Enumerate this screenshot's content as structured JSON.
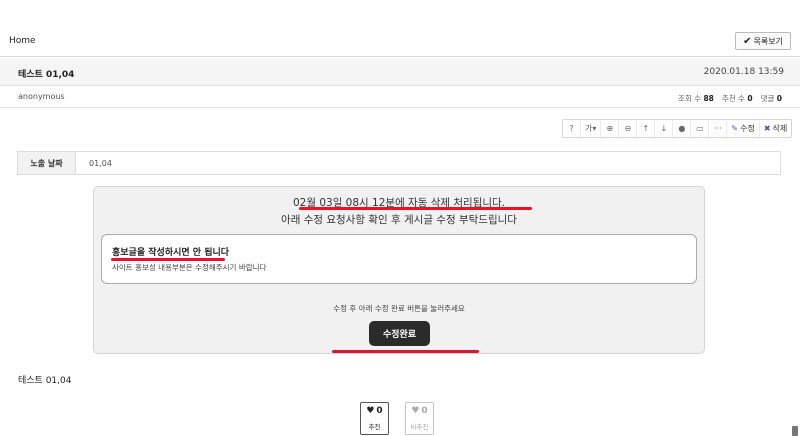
{
  "header": {
    "breadcrumb": "Home",
    "list_button": "목록보기",
    "list_button_icon": "checkmark-icon"
  },
  "post": {
    "title": "테스트 01,04",
    "date": "2020.01.18 13:59",
    "author": "anonymous",
    "views_label": "조회 수",
    "views": "88",
    "likes_label": "추천 수",
    "likes": "0",
    "comments_label": "댓글",
    "comments": "0",
    "body": "테스트 01,04"
  },
  "toolbar": {
    "help": "?",
    "font": "가",
    "font_caret": "▾",
    "zoom_in": "⊕",
    "zoom_out": "⊖",
    "up": "↑",
    "down": "↓",
    "comment": "●",
    "print": "▭",
    "more": "···",
    "edit_label": "수정",
    "delete_label": "삭제"
  },
  "exposure": {
    "label": "노출 날짜",
    "value": "01,04"
  },
  "notice": {
    "line1": "02월 03일 08시 12분에 자동 삭제 처리됩니다.",
    "line2": "아래 수정 요청사항 확인 후 게시글 수정 부탁드립니다",
    "request_title": "홍보글을 작성하시면 안 됩니다",
    "request_desc": "사이트 홍보성 내용부분은 수정해주시기 바랍니다",
    "done_hint": "수정 후 아래 수정 완료 버튼을 눌러주세요",
    "done_button": "수정완료"
  },
  "vote": {
    "up_count": "0",
    "up_label": "추천",
    "down_count": "0",
    "down_label": "비추천"
  },
  "colors": {
    "highlight": "#e8132a",
    "button_dark": "#2b2b2b"
  }
}
